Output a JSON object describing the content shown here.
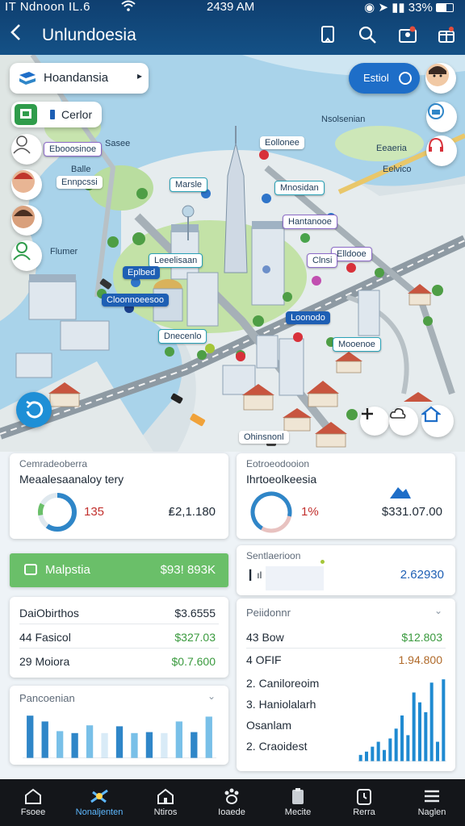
{
  "status": {
    "left": "IT Ndnoon IL.6",
    "time": "2439 AM",
    "right": "33%"
  },
  "appbar": {
    "title": "Unlundoesia"
  },
  "map": {
    "search_label": "Hoandansia",
    "layer_label": "Cerlor",
    "toggle_label": "Estiol",
    "place_labels": [
      "Nsolsenian",
      "Eeaeria",
      "Eelvico",
      "Sasee",
      "Balle",
      "Flumer"
    ],
    "tags": [
      "Ebooosinoe",
      "Marsle",
      "Eollonee",
      "Mnosidan",
      "Ennpcssi",
      "Hantanooe",
      "Elldooe",
      "Leeelisaan",
      "Eplbed",
      "Cloonnoeesoo",
      "Dnecenlo",
      "Loonodo",
      "Mooenoe",
      "Ohinsnonl",
      "Clnsi"
    ]
  },
  "cards": {
    "left_top": {
      "caption": "Cemradeoberra",
      "title": "Meaalesaanaloy tery",
      "ring_value": "135",
      "amount": "₤2,1.180",
      "ring_percent": 60
    },
    "right_top": {
      "caption": "Eotroeodooion",
      "title": "Ihrtoeolkeesia",
      "ring_value": "1%",
      "amount": "$331.07.00",
      "ring_percent": 70
    },
    "left_mid": {
      "label": "Malpstia",
      "value": "$93! 893K"
    },
    "right_mid": {
      "caption": "Sentlaerioon",
      "value": "2.62930"
    },
    "left_list": {
      "rows": [
        {
          "name": "DaiObirthos",
          "value": "$3.6555"
        },
        {
          "name": "44 Fasicol",
          "value": "$327.03"
        },
        {
          "name": "29 Moiora",
          "value": "$0.7.600"
        }
      ]
    },
    "right_list": {
      "caption": "Peiidonnr",
      "rows": [
        {
          "name": "43 Bow",
          "value": "$12.803"
        },
        {
          "name": "4 OFIF",
          "value": "1.94.800"
        },
        {
          "name": "2. Caniloreoim",
          "value": ""
        },
        {
          "name": "3. Haniolalarh",
          "value": ""
        },
        {
          "name": "Osanlam",
          "value": ""
        },
        {
          "name": "2. Craoidest",
          "value": ""
        }
      ]
    },
    "left_chart": {
      "caption": "Pancoenian"
    }
  },
  "chart_data": [
    {
      "type": "bar",
      "title": "Pancoenian",
      "values": [
        44,
        38,
        28,
        26,
        34,
        26,
        33,
        26,
        27,
        26,
        38,
        27,
        43
      ],
      "colors": [
        "#2f86c8",
        "#2f86c8",
        "#79c0e8",
        "#2f86c8",
        "#79c0e8",
        "#d9ebf7",
        "#2f86c8",
        "#79c0e8",
        "#2f86c8",
        "#d9ebf7",
        "#79c0e8",
        "#2f86c8",
        "#79c0e8"
      ],
      "ylim": [
        0,
        50
      ]
    },
    {
      "type": "bar",
      "values": [
        4,
        6,
        9,
        12,
        7,
        14,
        20,
        28,
        16,
        42,
        36,
        30,
        48,
        12,
        50
      ],
      "ylim": [
        0,
        55
      ]
    }
  ],
  "nav": [
    {
      "label": "Fsoee",
      "icon": "home-icon"
    },
    {
      "label": "Nonaljenten",
      "icon": "location-icon"
    },
    {
      "label": "Ntiros",
      "icon": "house-icon"
    },
    {
      "label": "Ioaede",
      "icon": "paw-icon"
    },
    {
      "label": "Mecite",
      "icon": "clipboard-icon"
    },
    {
      "label": "Rerra",
      "icon": "clock-icon"
    },
    {
      "label": "Naglen",
      "icon": "menu-icon"
    }
  ],
  "colors": {
    "accent": "#1e6ec8",
    "header": "#125087",
    "green_bar": "#6abf69"
  }
}
